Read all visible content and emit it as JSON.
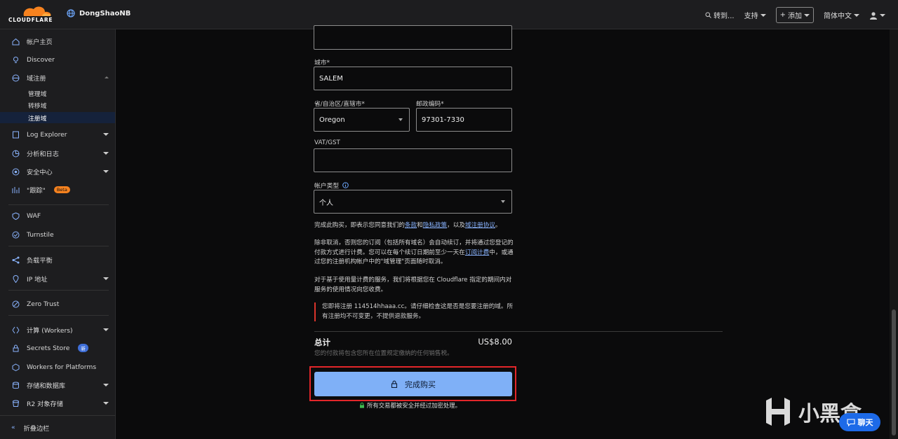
{
  "header": {
    "logo_text": "CLOUDFLARE",
    "account_name": "DongShaoNB",
    "goto_label": "转到...",
    "support_label": "支持",
    "add_label": "添加",
    "language_label": "简体中文"
  },
  "sidebar": {
    "home": "帐户主页",
    "discover": "Discover",
    "domain_reg": "域注册",
    "manage_domains": "管理域",
    "transfer_domains": "转移域",
    "register_domains": "注册域",
    "log_explorer": "Log Explorer",
    "analytics": "分析和日志",
    "security_center": "安全中心",
    "trace": "\"跟踪\"",
    "trace_badge": "Beta",
    "waf": "WAF",
    "turnstile": "Turnstile",
    "load_balancing": "负载平衡",
    "ip_address": "IP 地址",
    "zero_trust": "Zero Trust",
    "compute": "计算 (Workers)",
    "secrets_store": "Secrets Store",
    "secrets_badge": "新",
    "workers_platforms": "Workers for Platforms",
    "storage_db": "存储和数据库",
    "r2": "R2 对象存储",
    "collapse": "折叠边栏"
  },
  "form": {
    "city_label": "城市*",
    "city_value": "SALEM",
    "state_label": "省/自治区/直辖市*",
    "state_value": "Oregon",
    "postal_label": "邮政编码*",
    "postal_value": "97301-7330",
    "vat_label": "VAT/GST",
    "vat_value": "",
    "account_type_label": "帐户类型",
    "account_type_value": "个人"
  },
  "legal": {
    "p1_a": "完成此购买，即表示您同意我们的",
    "p1_terms": "条款",
    "p1_and": "和",
    "p1_privacy": "隐私政策",
    "p1_b": "，以及",
    "p1_reg": "域注册协议",
    "p1_end": "。",
    "p2_a": "除非取消，否则您的订阅（包括所有域名）会自动续订，并将通过您登记的付款方式进行计费。您可以在每个续订日期前至少一天在",
    "p2_link": "订阅计费",
    "p2_b": "中，或通过您的注册机构帐户中的\"域管理\"页面随时取消。",
    "p3": "对于基于使用量计费的服务，我们将根据您在 Cloudflare 指定的期间内对服务的使用情况向您收费。",
    "notice": "您即将注册 114514hhaaa.cc。请仔细检查这是否是您要注册的域。所有注册均不可变更，不提供退款服务。"
  },
  "summary": {
    "total_label": "总计",
    "total_value": "US$8.00",
    "tax_note": "您的付款将包含您所在位置规定缴纳的任何销售税。",
    "buy_label": "完成购买",
    "secure_note": "所有交易都被安全并经过加密处理。"
  },
  "overlay": {
    "watermark_text": "小黑盒",
    "chat_label": "聊天"
  }
}
